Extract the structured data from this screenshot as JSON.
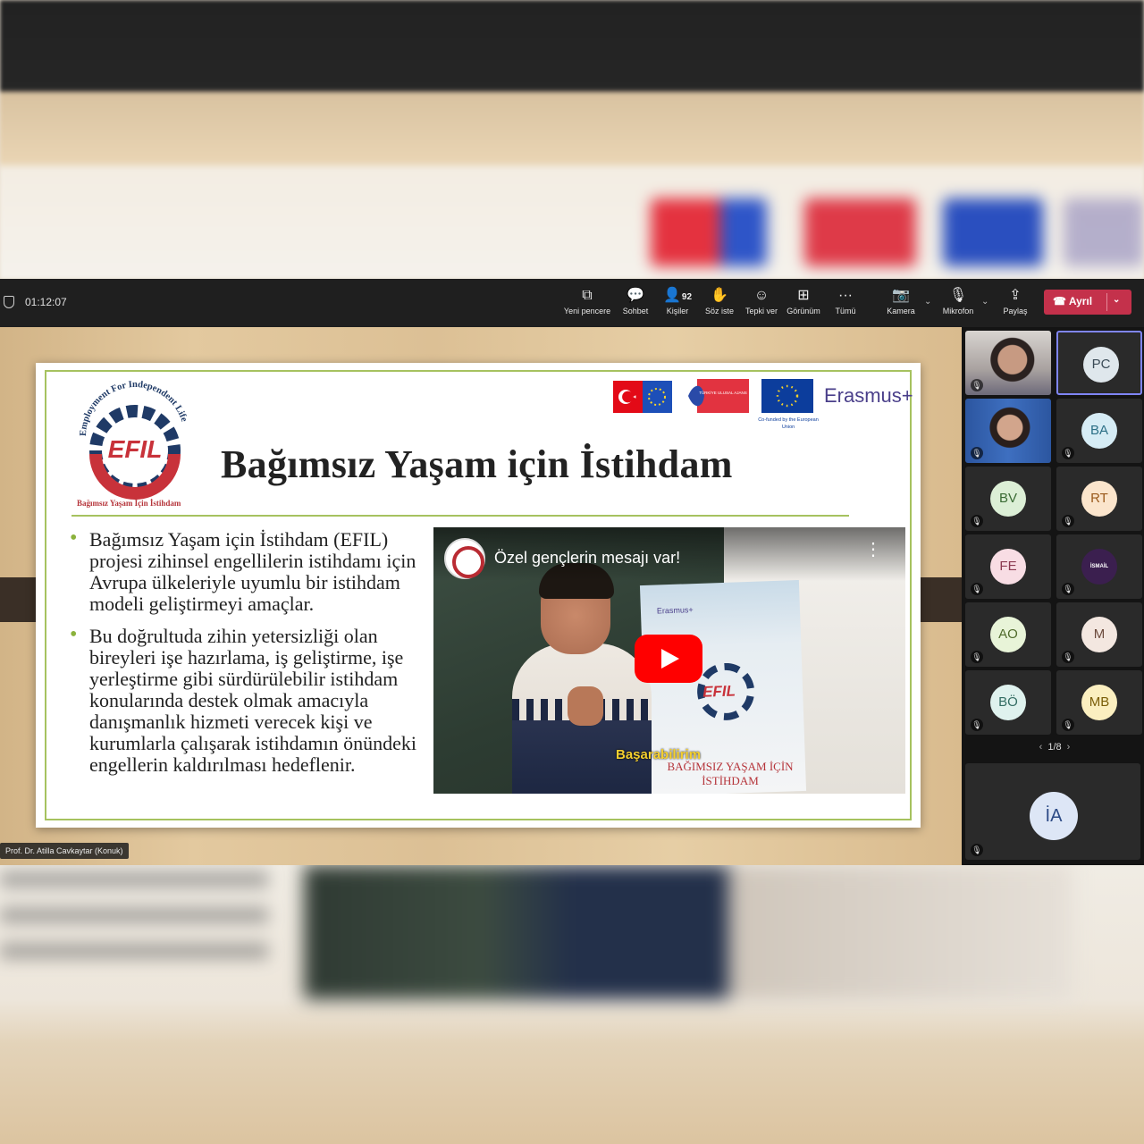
{
  "toolbar": {
    "timer": "01:12:07",
    "buttons": [
      {
        "label": "Yeni pencere",
        "icon": "new-window-icon"
      },
      {
        "label": "Sohbet",
        "icon": "chat-icon"
      },
      {
        "label": "Kişiler",
        "icon": "people-icon",
        "count": "92"
      },
      {
        "label": "Söz iste",
        "icon": "raise-hand-icon"
      },
      {
        "label": "Tepki ver",
        "icon": "reaction-icon"
      },
      {
        "label": "Görünüm",
        "icon": "view-icon"
      },
      {
        "label": "Tümü",
        "icon": "more-icon"
      },
      {
        "label": "Kamera",
        "icon": "camera-off-icon"
      },
      {
        "label": "Mikrofon",
        "icon": "mic-off-icon"
      },
      {
        "label": "Paylaş",
        "icon": "share-icon"
      }
    ],
    "leave_label": "Ayrıl"
  },
  "slide": {
    "logo_arc": "Employment For Independent Life",
    "logo_word": "EFIL",
    "logo_tagline": "Bağımsız Yaşam İçin İstihdam",
    "title": "Bağımsız Yaşam için İstihdam",
    "mid_logo": "TÜRKİYE ULUSAL AJANS",
    "eu_note": "Co-funded by the European Union",
    "erasmus": "Erasmus+",
    "bullets": [
      "Bağımsız Yaşam için İstihdam (EFIL) projesi zihinsel engellilerin istihdamı için Avrupa ülkeleriyle uyumlu bir istihdam modeli geliştirmeyi amaçlar.",
      "Bu doğrultuda zihin yetersizliği olan bireyleri işe hazırlama, iş geliştirme, işe yerleştirme gibi sürdürülebilir istihdam konularında destek olmak amacıyla danışmanlık hizmeti verecek kişi ve kurumlarla çalışarak istihdamın önündeki engellerin kaldırılması hedeflenir."
    ],
    "video": {
      "title": "Özel gençlerin mesajı var!",
      "caption": "Başarabilirim",
      "banner_text": "BAĞIMSIZ YAŞAM İÇİN İSTİHDAM",
      "banner_brand": "Erasmus+",
      "banner_logo": "EFIL"
    }
  },
  "presenter": "Prof. Dr. Atilla Cavkaytar (Konuk)",
  "participants": [
    {
      "initials": "",
      "type": "photo"
    },
    {
      "initials": "PC",
      "bg": "#dfe7ec",
      "fg": "#3b4b57",
      "selected": true
    },
    {
      "initials": "",
      "type": "photo"
    },
    {
      "initials": "BA",
      "bg": "#d6ecf5",
      "fg": "#2c6f86"
    },
    {
      "initials": "BV",
      "bg": "#dcefd6",
      "fg": "#3a6b34"
    },
    {
      "initials": "RT",
      "bg": "#fbe5cc",
      "fg": "#9a5a1b"
    },
    {
      "initials": "FE",
      "bg": "#f8dde4",
      "fg": "#8c3b52"
    },
    {
      "initials": "",
      "type": "badge",
      "badge": "İSMAİL"
    },
    {
      "initials": "AO",
      "bg": "#e8f4d8",
      "fg": "#506b2c"
    },
    {
      "initials": "M",
      "bg": "#f3e7e0",
      "fg": "#6b4a3c"
    },
    {
      "initials": "BÖ",
      "bg": "#dff2ee",
      "fg": "#336d63"
    },
    {
      "initials": "MB",
      "bg": "#fbefc0",
      "fg": "#7a5d08"
    }
  ],
  "pager": {
    "text": "1/8"
  },
  "big_tile": {
    "initials": "İA",
    "bg": "#dde6f6",
    "fg": "#2c4a86"
  }
}
